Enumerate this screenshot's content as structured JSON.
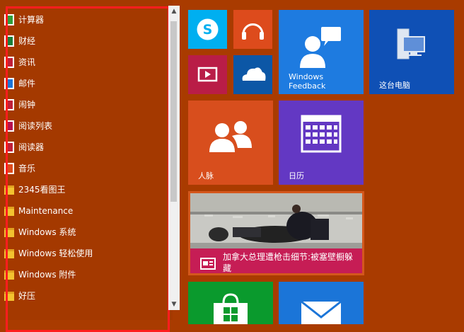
{
  "start_menu": {
    "app_list": [
      {
        "label": "计算器",
        "icon": "calculator-icon",
        "color": "#2f9e3a"
      },
      {
        "label": "财经",
        "icon": "finance-icon",
        "color": "#1a7f3a"
      },
      {
        "label": "资讯",
        "icon": "news-icon",
        "color": "#c0203a"
      },
      {
        "label": "邮件",
        "icon": "mail-icon",
        "color": "#1b75d8"
      },
      {
        "label": "闹钟",
        "icon": "alarm-icon",
        "color": "#c0203a"
      },
      {
        "label": "阅读列表",
        "icon": "reading-list-icon",
        "color": "#b7104f"
      },
      {
        "label": "阅读器",
        "icon": "reader-icon",
        "color": "#c0203a"
      },
      {
        "label": "音乐",
        "icon": "music-icon",
        "color": "#dd4b1c"
      },
      {
        "label": "2345看图王",
        "icon": "folder-icon",
        "color": "#f2c230"
      },
      {
        "label": "Maintenance",
        "icon": "folder-icon",
        "color": "#f2c230"
      },
      {
        "label": "Windows 系统",
        "icon": "folder-icon",
        "color": "#f2c230"
      },
      {
        "label": "Windows 轻松使用",
        "icon": "folder-icon",
        "color": "#f2c230"
      },
      {
        "label": "Windows 附件",
        "icon": "folder-icon",
        "color": "#f2c230"
      },
      {
        "label": "好压",
        "icon": "folder-icon",
        "color": "#f2c230"
      }
    ]
  },
  "tiles": {
    "feedback_label": "Windows\nFeedback",
    "pc_label": "这台电脑",
    "people_label": "人脉",
    "calendar_label": "日历",
    "news_headline": "加拿大总理遭枪击细节:被塞壁橱躲藏"
  },
  "colors": {
    "background": "#a93b00",
    "highlight_frame": "#ff1e1e"
  }
}
